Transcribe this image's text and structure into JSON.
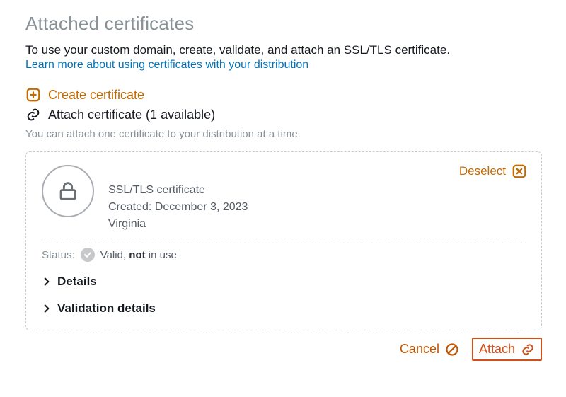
{
  "header": {
    "title": "Attached certificates",
    "intro": "To use your custom domain, create, validate, and attach an SSL/TLS certificate.",
    "learn_link": "Learn more about using certificates with your distribution"
  },
  "actions": {
    "create_label": "Create certificate",
    "attach_label": "Attach certificate (1 available)"
  },
  "hint": "You can attach one certificate to your distribution at a time.",
  "card": {
    "deselect_label": "Deselect",
    "cert": {
      "name": "SSL/TLS certificate",
      "created": "Created: December 3, 2023",
      "region": "Virginia"
    },
    "status": {
      "label": "Status:",
      "valid_text": "Valid, ",
      "not": "not",
      "suffix": " in use"
    },
    "expanders": {
      "details": "Details",
      "validation": "Validation details"
    }
  },
  "footer": {
    "cancel": "Cancel",
    "attach": "Attach"
  },
  "colors": {
    "accent": "#c36a00",
    "link": "#0073bb"
  }
}
